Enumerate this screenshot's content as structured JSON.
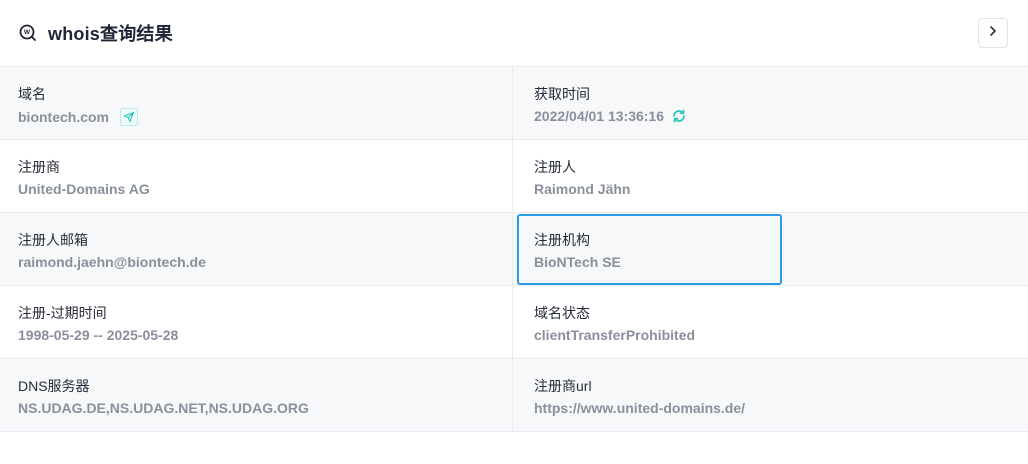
{
  "header": {
    "title": "whois查询结果",
    "logo_icon": "whois-logo-icon",
    "next_icon": "chevron-right-icon"
  },
  "fields": {
    "domain": {
      "label": "域名",
      "value": "biontech.com",
      "action_icon": "send-icon"
    },
    "fetch_time": {
      "label": "获取时间",
      "value": "2022/04/01 13:36:16",
      "action_icon": "refresh-icon"
    },
    "registrar": {
      "label": "注册商",
      "value": "United-Domains AG"
    },
    "registrant": {
      "label": "注册人",
      "value": "Raimond Jähn"
    },
    "registrant_email": {
      "label": "注册人邮箱",
      "value": "raimond.jaehn@biontech.de"
    },
    "registrant_org": {
      "label": "注册机构",
      "value": "BioNTech SE"
    },
    "reg_expiry": {
      "label": "注册-过期时间",
      "value": "1998-05-29 -- 2025-05-28"
    },
    "domain_status": {
      "label": "域名状态",
      "value": "clientTransferProhibited"
    },
    "dns_servers": {
      "label": "DNS服务器",
      "value": "NS.UDAG.DE,NS.UDAG.NET,NS.UDAG.ORG"
    },
    "registrar_url": {
      "label": "注册商url",
      "value": "https://www.united-domains.de/"
    }
  },
  "colors": {
    "accent_teal": "#2cc5bd",
    "highlight_blue": "#2b9ce6",
    "value_gray": "#8a8f9c"
  }
}
